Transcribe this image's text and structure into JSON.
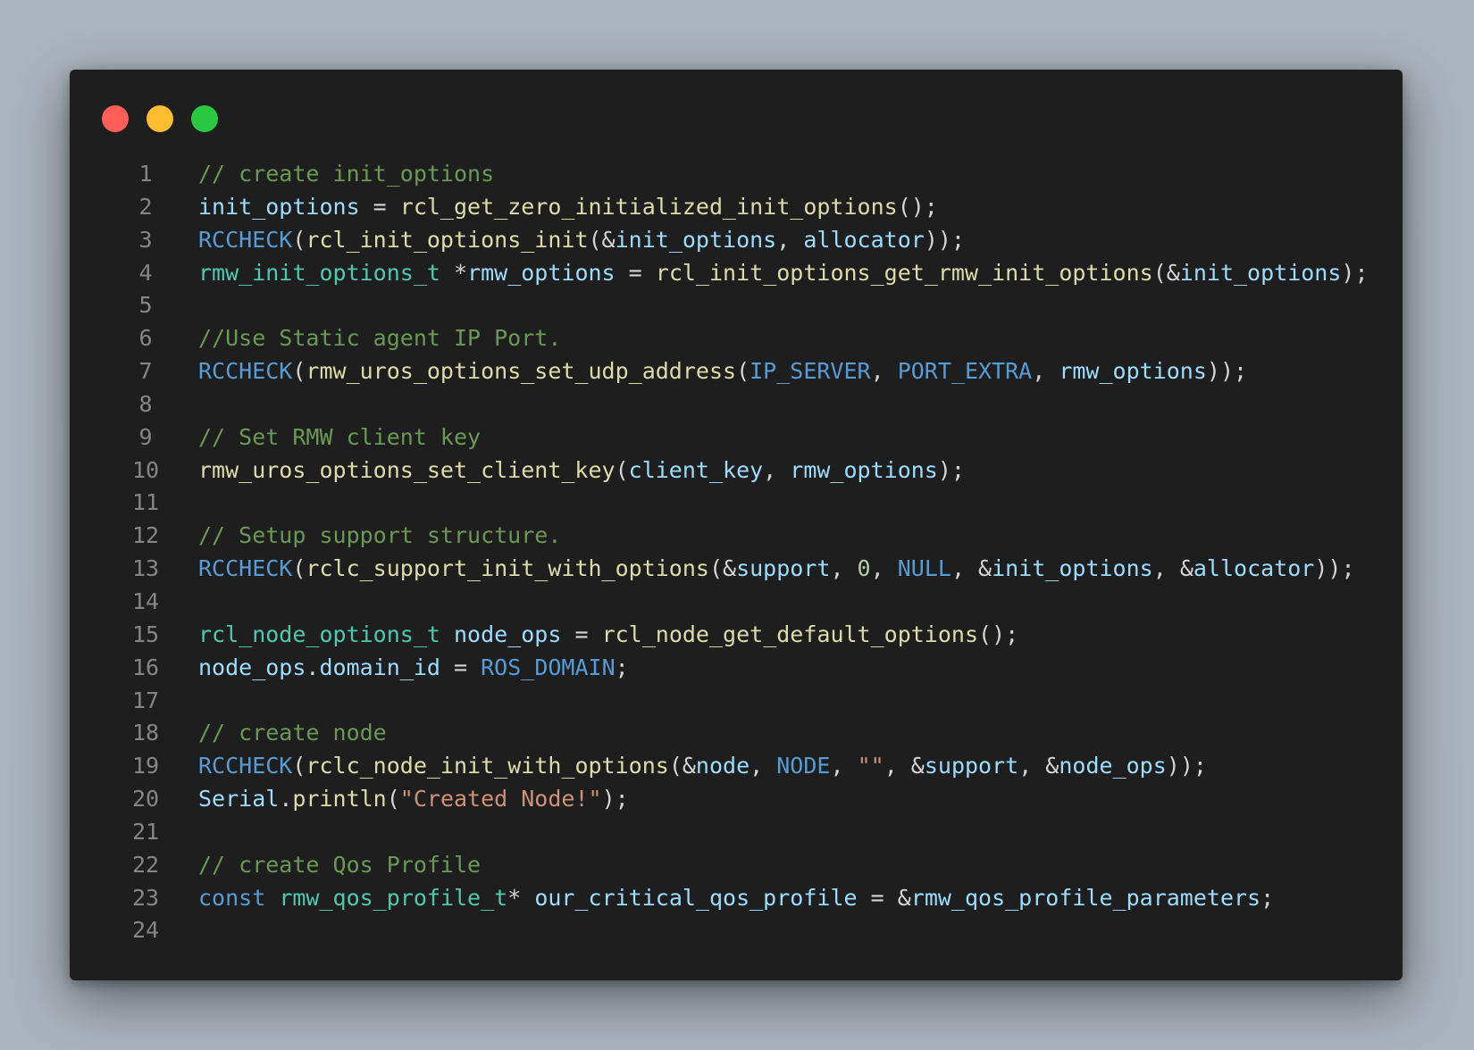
{
  "window": {
    "traffic_lights": [
      {
        "name": "close",
        "color": "#ff5f57"
      },
      {
        "name": "minimize",
        "color": "#febc2e"
      },
      {
        "name": "maximize",
        "color": "#28c840"
      }
    ]
  },
  "colors": {
    "comment": "#6a9955",
    "function": "#dcdcaa",
    "variable": "#9cdcfe",
    "macro": "#569cd6",
    "type": "#4ec9b0",
    "string": "#ce9178",
    "number": "#b5cea8",
    "punct": "#d4d4d4"
  },
  "code": {
    "lines": [
      {
        "n": "1",
        "tokens": [
          {
            "t": "// create init_options",
            "k": "comment"
          }
        ]
      },
      {
        "n": "2",
        "tokens": [
          {
            "t": "init_options",
            "k": "variable"
          },
          {
            "t": " = ",
            "k": "punct"
          },
          {
            "t": "rcl_get_zero_initialized_init_options",
            "k": "function"
          },
          {
            "t": "();",
            "k": "punct"
          }
        ]
      },
      {
        "n": "3",
        "tokens": [
          {
            "t": "RCCHECK",
            "k": "macro"
          },
          {
            "t": "(",
            "k": "punct"
          },
          {
            "t": "rcl_init_options_init",
            "k": "function"
          },
          {
            "t": "(&",
            "k": "punct"
          },
          {
            "t": "init_options",
            "k": "variable"
          },
          {
            "t": ", ",
            "k": "punct"
          },
          {
            "t": "allocator",
            "k": "variable"
          },
          {
            "t": "));",
            "k": "punct"
          }
        ]
      },
      {
        "n": "4",
        "tokens": [
          {
            "t": "rmw_init_options_t",
            "k": "type"
          },
          {
            "t": " *",
            "k": "punct"
          },
          {
            "t": "rmw_options",
            "k": "variable"
          },
          {
            "t": " = ",
            "k": "punct"
          },
          {
            "t": "rcl_init_options_get_rmw_init_options",
            "k": "function"
          },
          {
            "t": "(&",
            "k": "punct"
          },
          {
            "t": "init_options",
            "k": "variable"
          },
          {
            "t": ");",
            "k": "punct"
          }
        ]
      },
      {
        "n": "5",
        "tokens": []
      },
      {
        "n": "6",
        "tokens": [
          {
            "t": "//Use Static agent IP Port.",
            "k": "comment"
          }
        ]
      },
      {
        "n": "7",
        "tokens": [
          {
            "t": "RCCHECK",
            "k": "macro"
          },
          {
            "t": "(",
            "k": "punct"
          },
          {
            "t": "rmw_uros_options_set_udp_address",
            "k": "function"
          },
          {
            "t": "(",
            "k": "punct"
          },
          {
            "t": "IP_SERVER",
            "k": "macro"
          },
          {
            "t": ", ",
            "k": "punct"
          },
          {
            "t": "PORT_EXTRA",
            "k": "macro"
          },
          {
            "t": ", ",
            "k": "punct"
          },
          {
            "t": "rmw_options",
            "k": "variable"
          },
          {
            "t": "));",
            "k": "punct"
          }
        ]
      },
      {
        "n": "8",
        "tokens": []
      },
      {
        "n": "9",
        "tokens": [
          {
            "t": "// Set RMW client key",
            "k": "comment"
          }
        ]
      },
      {
        "n": "10",
        "tokens": [
          {
            "t": "rmw_uros_options_set_client_key",
            "k": "function"
          },
          {
            "t": "(",
            "k": "punct"
          },
          {
            "t": "client_key",
            "k": "variable"
          },
          {
            "t": ", ",
            "k": "punct"
          },
          {
            "t": "rmw_options",
            "k": "variable"
          },
          {
            "t": ");",
            "k": "punct"
          }
        ]
      },
      {
        "n": "11",
        "tokens": []
      },
      {
        "n": "12",
        "tokens": [
          {
            "t": "// Setup support structure.",
            "k": "comment"
          }
        ]
      },
      {
        "n": "13",
        "tokens": [
          {
            "t": "RCCHECK",
            "k": "macro"
          },
          {
            "t": "(",
            "k": "punct"
          },
          {
            "t": "rclc_support_init_with_options",
            "k": "function"
          },
          {
            "t": "(&",
            "k": "punct"
          },
          {
            "t": "support",
            "k": "variable"
          },
          {
            "t": ", ",
            "k": "punct"
          },
          {
            "t": "0",
            "k": "number"
          },
          {
            "t": ", ",
            "k": "punct"
          },
          {
            "t": "NULL",
            "k": "macro"
          },
          {
            "t": ", &",
            "k": "punct"
          },
          {
            "t": "init_options",
            "k": "variable"
          },
          {
            "t": ", &",
            "k": "punct"
          },
          {
            "t": "allocator",
            "k": "variable"
          },
          {
            "t": "));",
            "k": "punct"
          }
        ]
      },
      {
        "n": "14",
        "tokens": []
      },
      {
        "n": "15",
        "tokens": [
          {
            "t": "rcl_node_options_t",
            "k": "type"
          },
          {
            "t": " ",
            "k": "punct"
          },
          {
            "t": "node_ops",
            "k": "variable"
          },
          {
            "t": " = ",
            "k": "punct"
          },
          {
            "t": "rcl_node_get_default_options",
            "k": "function"
          },
          {
            "t": "();",
            "k": "punct"
          }
        ]
      },
      {
        "n": "16",
        "tokens": [
          {
            "t": "node_ops",
            "k": "variable"
          },
          {
            "t": ".",
            "k": "punct"
          },
          {
            "t": "domain_id",
            "k": "variable"
          },
          {
            "t": " = ",
            "k": "punct"
          },
          {
            "t": "ROS_DOMAIN",
            "k": "macro"
          },
          {
            "t": ";",
            "k": "punct"
          }
        ]
      },
      {
        "n": "17",
        "tokens": []
      },
      {
        "n": "18",
        "tokens": [
          {
            "t": "// create node",
            "k": "comment"
          }
        ]
      },
      {
        "n": "19",
        "tokens": [
          {
            "t": "RCCHECK",
            "k": "macro"
          },
          {
            "t": "(",
            "k": "punct"
          },
          {
            "t": "rclc_node_init_with_options",
            "k": "function"
          },
          {
            "t": "(&",
            "k": "punct"
          },
          {
            "t": "node",
            "k": "variable"
          },
          {
            "t": ", ",
            "k": "punct"
          },
          {
            "t": "NODE",
            "k": "macro"
          },
          {
            "t": ", ",
            "k": "punct"
          },
          {
            "t": "\"\"",
            "k": "string"
          },
          {
            "t": ", &",
            "k": "punct"
          },
          {
            "t": "support",
            "k": "variable"
          },
          {
            "t": ", &",
            "k": "punct"
          },
          {
            "t": "node_ops",
            "k": "variable"
          },
          {
            "t": "));",
            "k": "punct"
          }
        ]
      },
      {
        "n": "20",
        "tokens": [
          {
            "t": "Serial",
            "k": "variable"
          },
          {
            "t": ".",
            "k": "punct"
          },
          {
            "t": "println",
            "k": "function"
          },
          {
            "t": "(",
            "k": "punct"
          },
          {
            "t": "\"Created Node!\"",
            "k": "string"
          },
          {
            "t": ");",
            "k": "punct"
          }
        ]
      },
      {
        "n": "21",
        "tokens": []
      },
      {
        "n": "22",
        "tokens": [
          {
            "t": "// create Qos Profile",
            "k": "comment"
          }
        ]
      },
      {
        "n": "23",
        "tokens": [
          {
            "t": "const",
            "k": "macro"
          },
          {
            "t": " ",
            "k": "punct"
          },
          {
            "t": "rmw_qos_profile_t",
            "k": "type"
          },
          {
            "t": "* ",
            "k": "punct"
          },
          {
            "t": "our_critical_qos_profile",
            "k": "variable"
          },
          {
            "t": " = &",
            "k": "punct"
          },
          {
            "t": "rmw_qos_profile_parameters",
            "k": "variable"
          },
          {
            "t": ";",
            "k": "punct"
          }
        ]
      },
      {
        "n": "24",
        "tokens": []
      }
    ]
  }
}
